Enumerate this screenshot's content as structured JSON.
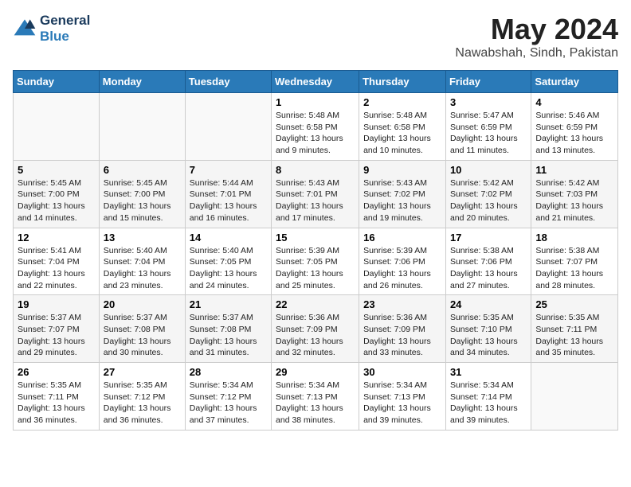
{
  "logo": {
    "line1": "General",
    "line2": "Blue"
  },
  "title": "May 2024",
  "location": "Nawabshah, Sindh, Pakistan",
  "days_of_week": [
    "Sunday",
    "Monday",
    "Tuesday",
    "Wednesday",
    "Thursday",
    "Friday",
    "Saturday"
  ],
  "weeks": [
    [
      {
        "day": "",
        "info": ""
      },
      {
        "day": "",
        "info": ""
      },
      {
        "day": "",
        "info": ""
      },
      {
        "day": "1",
        "info": "Sunrise: 5:48 AM\nSunset: 6:58 PM\nDaylight: 13 hours\nand 9 minutes."
      },
      {
        "day": "2",
        "info": "Sunrise: 5:48 AM\nSunset: 6:58 PM\nDaylight: 13 hours\nand 10 minutes."
      },
      {
        "day": "3",
        "info": "Sunrise: 5:47 AM\nSunset: 6:59 PM\nDaylight: 13 hours\nand 11 minutes."
      },
      {
        "day": "4",
        "info": "Sunrise: 5:46 AM\nSunset: 6:59 PM\nDaylight: 13 hours\nand 13 minutes."
      }
    ],
    [
      {
        "day": "5",
        "info": "Sunrise: 5:45 AM\nSunset: 7:00 PM\nDaylight: 13 hours\nand 14 minutes."
      },
      {
        "day": "6",
        "info": "Sunrise: 5:45 AM\nSunset: 7:00 PM\nDaylight: 13 hours\nand 15 minutes."
      },
      {
        "day": "7",
        "info": "Sunrise: 5:44 AM\nSunset: 7:01 PM\nDaylight: 13 hours\nand 16 minutes."
      },
      {
        "day": "8",
        "info": "Sunrise: 5:43 AM\nSunset: 7:01 PM\nDaylight: 13 hours\nand 17 minutes."
      },
      {
        "day": "9",
        "info": "Sunrise: 5:43 AM\nSunset: 7:02 PM\nDaylight: 13 hours\nand 19 minutes."
      },
      {
        "day": "10",
        "info": "Sunrise: 5:42 AM\nSunset: 7:02 PM\nDaylight: 13 hours\nand 20 minutes."
      },
      {
        "day": "11",
        "info": "Sunrise: 5:42 AM\nSunset: 7:03 PM\nDaylight: 13 hours\nand 21 minutes."
      }
    ],
    [
      {
        "day": "12",
        "info": "Sunrise: 5:41 AM\nSunset: 7:04 PM\nDaylight: 13 hours\nand 22 minutes."
      },
      {
        "day": "13",
        "info": "Sunrise: 5:40 AM\nSunset: 7:04 PM\nDaylight: 13 hours\nand 23 minutes."
      },
      {
        "day": "14",
        "info": "Sunrise: 5:40 AM\nSunset: 7:05 PM\nDaylight: 13 hours\nand 24 minutes."
      },
      {
        "day": "15",
        "info": "Sunrise: 5:39 AM\nSunset: 7:05 PM\nDaylight: 13 hours\nand 25 minutes."
      },
      {
        "day": "16",
        "info": "Sunrise: 5:39 AM\nSunset: 7:06 PM\nDaylight: 13 hours\nand 26 minutes."
      },
      {
        "day": "17",
        "info": "Sunrise: 5:38 AM\nSunset: 7:06 PM\nDaylight: 13 hours\nand 27 minutes."
      },
      {
        "day": "18",
        "info": "Sunrise: 5:38 AM\nSunset: 7:07 PM\nDaylight: 13 hours\nand 28 minutes."
      }
    ],
    [
      {
        "day": "19",
        "info": "Sunrise: 5:37 AM\nSunset: 7:07 PM\nDaylight: 13 hours\nand 29 minutes."
      },
      {
        "day": "20",
        "info": "Sunrise: 5:37 AM\nSunset: 7:08 PM\nDaylight: 13 hours\nand 30 minutes."
      },
      {
        "day": "21",
        "info": "Sunrise: 5:37 AM\nSunset: 7:08 PM\nDaylight: 13 hours\nand 31 minutes."
      },
      {
        "day": "22",
        "info": "Sunrise: 5:36 AM\nSunset: 7:09 PM\nDaylight: 13 hours\nand 32 minutes."
      },
      {
        "day": "23",
        "info": "Sunrise: 5:36 AM\nSunset: 7:09 PM\nDaylight: 13 hours\nand 33 minutes."
      },
      {
        "day": "24",
        "info": "Sunrise: 5:35 AM\nSunset: 7:10 PM\nDaylight: 13 hours\nand 34 minutes."
      },
      {
        "day": "25",
        "info": "Sunrise: 5:35 AM\nSunset: 7:11 PM\nDaylight: 13 hours\nand 35 minutes."
      }
    ],
    [
      {
        "day": "26",
        "info": "Sunrise: 5:35 AM\nSunset: 7:11 PM\nDaylight: 13 hours\nand 36 minutes."
      },
      {
        "day": "27",
        "info": "Sunrise: 5:35 AM\nSunset: 7:12 PM\nDaylight: 13 hours\nand 36 minutes."
      },
      {
        "day": "28",
        "info": "Sunrise: 5:34 AM\nSunset: 7:12 PM\nDaylight: 13 hours\nand 37 minutes."
      },
      {
        "day": "29",
        "info": "Sunrise: 5:34 AM\nSunset: 7:13 PM\nDaylight: 13 hours\nand 38 minutes."
      },
      {
        "day": "30",
        "info": "Sunrise: 5:34 AM\nSunset: 7:13 PM\nDaylight: 13 hours\nand 39 minutes."
      },
      {
        "day": "31",
        "info": "Sunrise: 5:34 AM\nSunset: 7:14 PM\nDaylight: 13 hours\nand 39 minutes."
      },
      {
        "day": "",
        "info": ""
      }
    ]
  ]
}
